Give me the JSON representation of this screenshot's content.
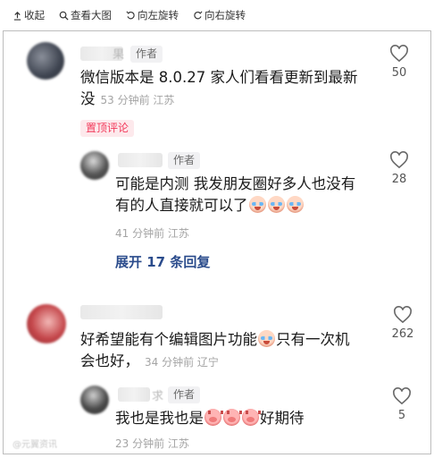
{
  "toolbar": {
    "collapse": "收起",
    "view_large": "查看大图",
    "rotate_left": "向左旋转",
    "rotate_right": "向右旋转"
  },
  "comments": [
    {
      "name_tail": "果",
      "author_tag": "作者",
      "text_line1": "微信版本是 8.0.27  家人们看看更新到最新",
      "text_line2": "没",
      "meta": "53 分钟前 江苏",
      "pinned": "置顶评论",
      "likes": "50"
    },
    {
      "name_tail": "",
      "author_tag": "作者",
      "text_line1": "可能是内测 我发朋友圈好多人也没有",
      "text_line2": "有的人直接就可以了",
      "meta": "41 分钟前 江苏",
      "likes": "28",
      "emoji": [
        "cry-emoji",
        "cry-emoji",
        "cry-emoji"
      ]
    },
    {
      "expand": "展开 17 条回复"
    },
    {
      "name_tail": "",
      "text_line1_a": "好希望能有个编辑图片功能",
      "text_line1_b": "只有一次机",
      "text_line2": "会也好，",
      "meta": "34 分钟前 辽宁",
      "likes": "262",
      "emoji": [
        "cry-emoji"
      ]
    },
    {
      "name_tail": "求",
      "author_tag": "作者",
      "text_a": "我也是我也是",
      "text_b": "好期待",
      "meta": "23 分钟前 江苏",
      "likes": "5",
      "emoji": [
        "pig-emoji",
        "pig-emoji",
        "pig-emoji"
      ]
    }
  ],
  "watermark": "@元翼资讯"
}
